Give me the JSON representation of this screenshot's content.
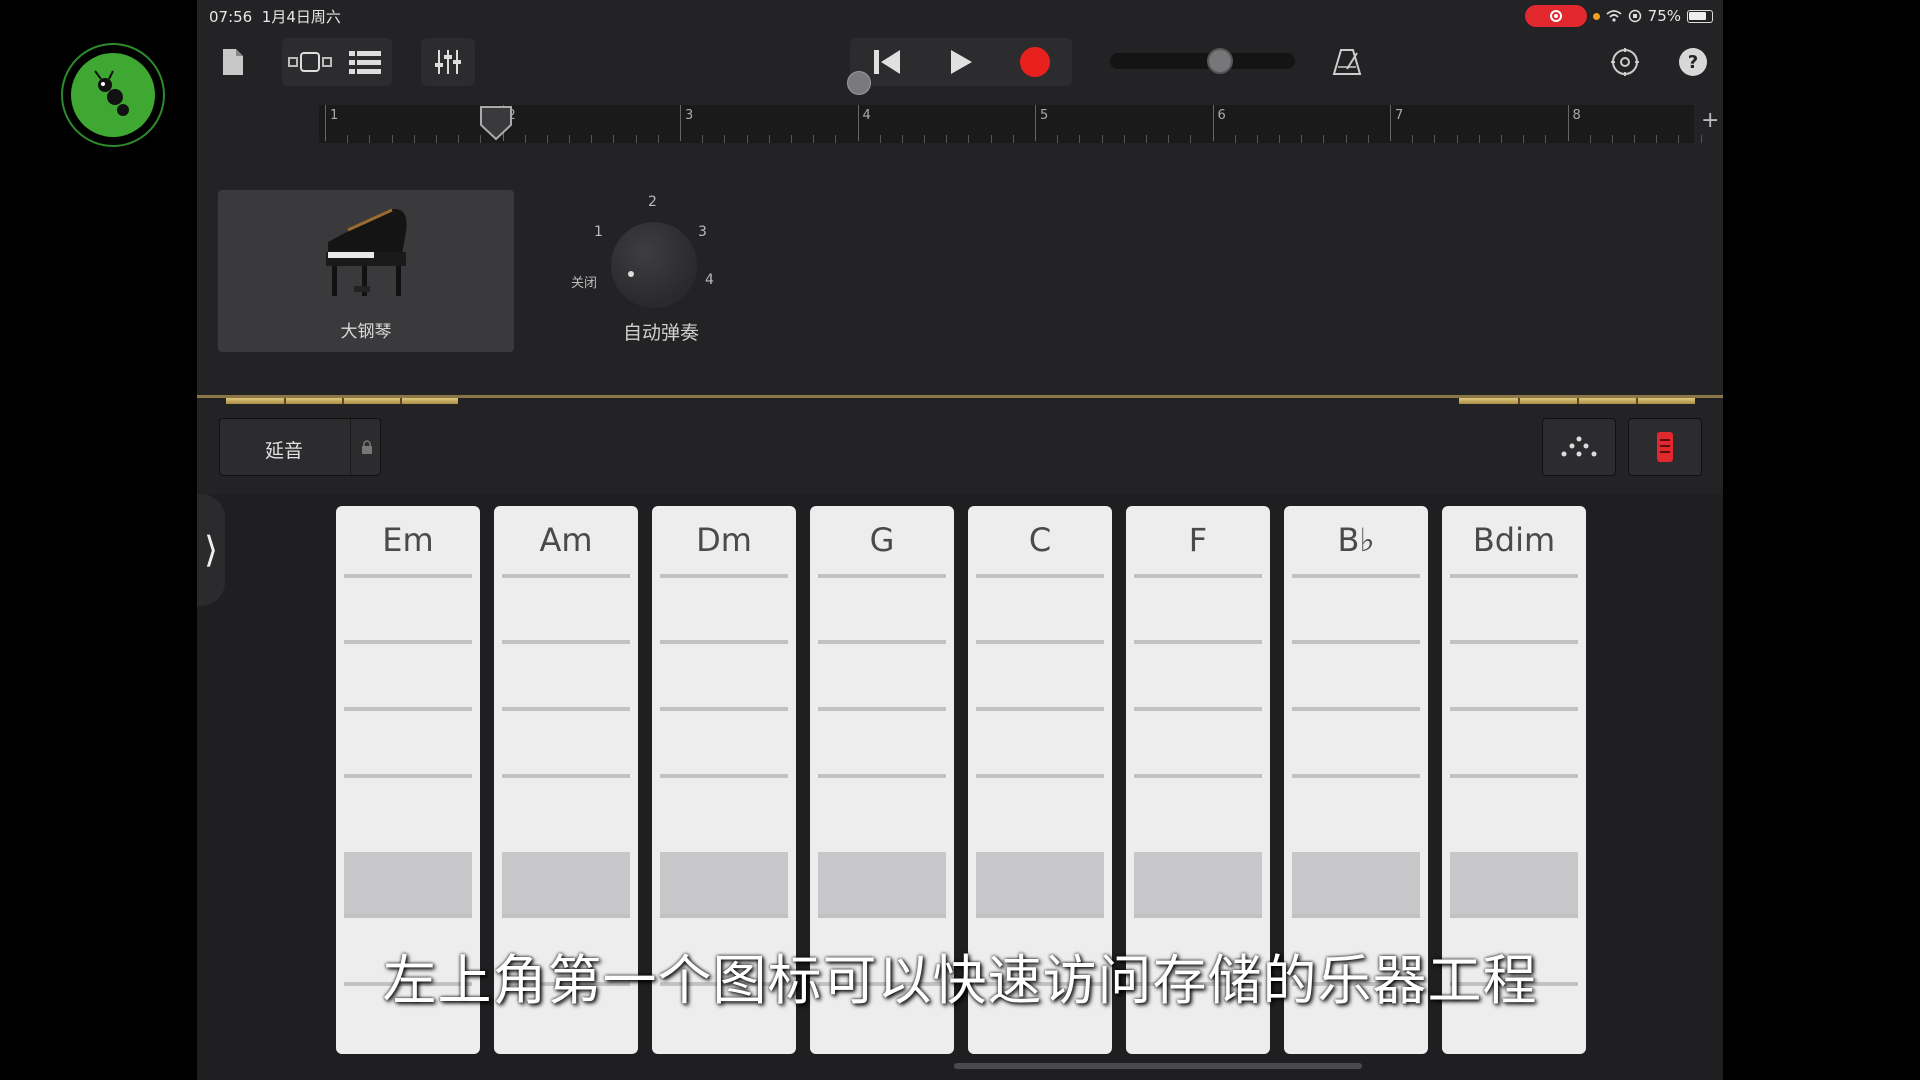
{
  "status": {
    "time": "07:56",
    "date": "1月4日周六",
    "battery": "75%"
  },
  "timeline": {
    "bars": [
      "1",
      "2",
      "3",
      "4",
      "5",
      "6",
      "7",
      "8"
    ],
    "add_icon": "plus-icon"
  },
  "instrument": {
    "name": "大钢琴"
  },
  "autoplay": {
    "title": "自动弹奏",
    "labels": {
      "off": "关闭",
      "one": "1",
      "two": "2",
      "three": "3",
      "four": "4"
    }
  },
  "controls": {
    "sustain_label": "延音"
  },
  "chords": [
    "Em",
    "Am",
    "Dm",
    "G",
    "C",
    "F",
    "B♭",
    "Bdim"
  ],
  "subtitle": "左上角第一个图标可以快速访问存储的乐器工程",
  "colors": {
    "record": "#e8211f",
    "gold": "#d9bf6e",
    "logo_green": "#3ea832"
  }
}
